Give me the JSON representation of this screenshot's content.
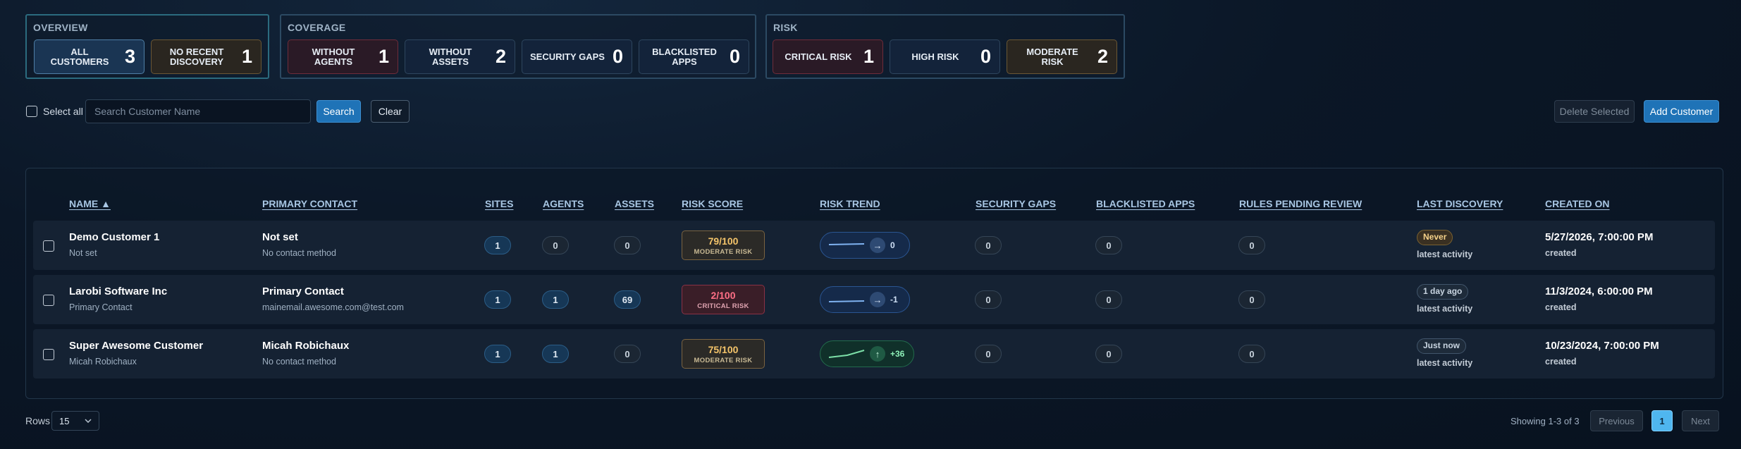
{
  "overview": {
    "title": "OVERVIEW",
    "cards": [
      {
        "label": "ALL CUSTOMERS",
        "value": "3"
      },
      {
        "label": "NO RECENT DISCOVERY",
        "value": "1"
      }
    ]
  },
  "coverage": {
    "title": "COVERAGE",
    "cards": [
      {
        "label": "WITHOUT AGENTS",
        "value": "1"
      },
      {
        "label": "WITHOUT ASSETS",
        "value": "2"
      },
      {
        "label": "SECURITY GAPS",
        "value": "0"
      },
      {
        "label": "BLACKLISTED APPS",
        "value": "0"
      }
    ]
  },
  "risk": {
    "title": "RISK",
    "cards": [
      {
        "label": "CRITICAL RISK",
        "value": "1"
      },
      {
        "label": "HIGH RISK",
        "value": "0"
      },
      {
        "label": "MODERATE RISK",
        "value": "2"
      }
    ]
  },
  "toolbar": {
    "select_all_label": "Select all",
    "search_placeholder": "Search Customer Name",
    "search_label": "Search",
    "clear_label": "Clear",
    "delete_selected_label": "Delete Selected",
    "add_customer_label": "Add Customer"
  },
  "table": {
    "headers": {
      "name": "NAME ▲",
      "primary_contact": "PRIMARY CONTACT",
      "sites": "SITES",
      "agents": "AGENTS",
      "assets": "ASSETS",
      "risk_score": "RISK SCORE",
      "risk_trend": "RISK TREND",
      "security_gaps": "SECURITY GAPS",
      "blacklisted_apps": "BLACKLISTED APPS",
      "rules_pending_review": "RULES PENDING REVIEW",
      "last_discovery": "LAST DISCOVERY",
      "created_on": "CREATED ON"
    },
    "rows": [
      {
        "name": "Demo Customer 1",
        "name_sub": "Not set",
        "contact": "Not set",
        "contact_sub": "No contact method",
        "sites": "1",
        "agents": "0",
        "assets": "0",
        "risk_score": "79/100",
        "risk_level": "MODERATE RISK",
        "trend_arrow": "→",
        "trend_value": "0",
        "security_gaps": "0",
        "blacklisted_apps": "0",
        "rules_pending": "0",
        "last_discovery": "Never",
        "last_discovery_sub": "latest activity",
        "created_on": "5/27/2026, 7:00:00 PM",
        "created_sub": "created"
      },
      {
        "name": "Larobi Software Inc",
        "name_sub": "Primary Contact",
        "contact": "Primary Contact",
        "contact_sub": "mainemail.awesome.com@test.com",
        "sites": "1",
        "agents": "1",
        "assets": "69",
        "risk_score": "2/100",
        "risk_level": "CRITICAL RISK",
        "trend_arrow": "→",
        "trend_value": "-1",
        "security_gaps": "0",
        "blacklisted_apps": "0",
        "rules_pending": "0",
        "last_discovery": "1 day ago",
        "last_discovery_sub": "latest activity",
        "created_on": "11/3/2024, 6:00:00 PM",
        "created_sub": "created"
      },
      {
        "name": "Super Awesome Customer",
        "name_sub": "Micah Robichaux",
        "contact": "Micah Robichaux",
        "contact_sub": "No contact method",
        "sites": "1",
        "agents": "1",
        "assets": "0",
        "risk_score": "75/100",
        "risk_level": "MODERATE RISK",
        "trend_arrow": "↑",
        "trend_value": "+36",
        "security_gaps": "0",
        "blacklisted_apps": "0",
        "rules_pending": "0",
        "last_discovery": "Just now",
        "last_discovery_sub": "latest activity",
        "created_on": "10/23/2024, 7:00:00 PM",
        "created_sub": "created"
      }
    ]
  },
  "footer": {
    "rows_label": "Rows",
    "rows_value": "15",
    "showing": "Showing 1-3 of 3",
    "previous_label": "Previous",
    "current_page": "1",
    "next_label": "Next"
  },
  "colors": {
    "accent": "#1f73b7",
    "moderate": "#f4c46a",
    "critical": "#ff6f86",
    "trend_up": "#8ef0b8"
  }
}
